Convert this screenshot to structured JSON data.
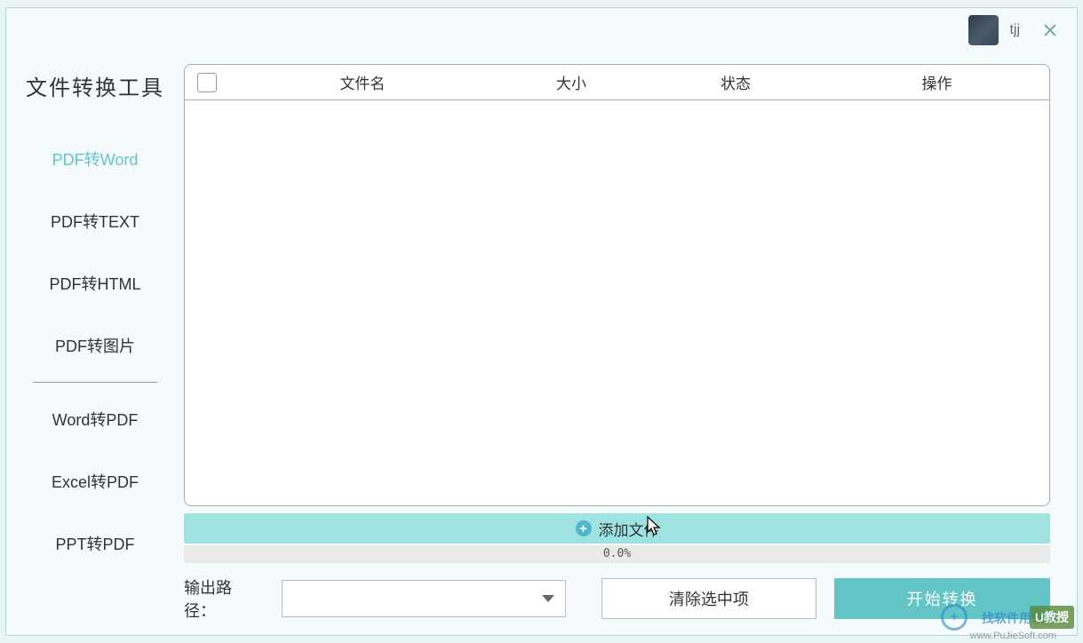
{
  "titlebar": {
    "username": "tjj"
  },
  "sidebar": {
    "title": "文件转换工具",
    "items": [
      {
        "label": "PDF转Word",
        "active": true
      },
      {
        "label": "PDF转TEXT",
        "active": false
      },
      {
        "label": "PDF转HTML",
        "active": false
      },
      {
        "label": "PDF转图片",
        "active": false
      },
      {
        "label": "Word转PDF",
        "active": false
      },
      {
        "label": "Excel转PDF",
        "active": false
      },
      {
        "label": "PPT转PDF",
        "active": false
      }
    ]
  },
  "table": {
    "headers": {
      "filename": "文件名",
      "size": "大小",
      "status": "状态",
      "action": "操作"
    }
  },
  "addFile": {
    "label": "添加文件"
  },
  "progress": {
    "text": "0.0%"
  },
  "output": {
    "label": "输出路径："
  },
  "buttons": {
    "clear": "清除选中项",
    "start": "开始转换"
  },
  "watermark": {
    "text1": "找软件用软件",
    "text2": "www.PuJieSoft.com",
    "u": "U教授"
  }
}
